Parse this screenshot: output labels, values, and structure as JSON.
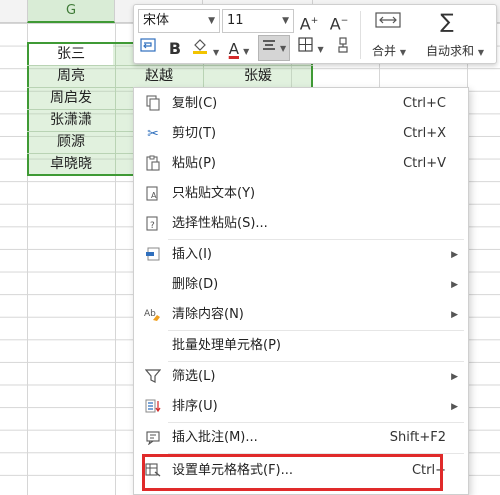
{
  "sheet": {
    "column_g": "G",
    "cells": {
      "g1": "张三",
      "g2": "周亮",
      "h2": "赵越",
      "i2": "张媛",
      "g3": "周启发",
      "g4": "张潇潇",
      "g5": "顾源",
      "g6": "卓晓晓"
    }
  },
  "toolbar": {
    "font_name": "宋体",
    "font_size": "11",
    "increase_font_icon": "A⁺",
    "decrease_font_icon": "A⁻",
    "bold_label": "B",
    "font_color_label": "A",
    "merge_label": "合并",
    "autosum_label": "自动求和",
    "colors": {
      "font_color": "#d42a2a",
      "fill_color": "#f2c400"
    }
  },
  "context_menu": {
    "items": {
      "copy": {
        "label": "复制(C)",
        "shortcut": "Ctrl+C",
        "icon": "copy-icon"
      },
      "cut": {
        "label": "剪切(T)",
        "shortcut": "Ctrl+X",
        "icon": "scissors-icon"
      },
      "paste": {
        "label": "粘贴(P)",
        "shortcut": "Ctrl+V",
        "icon": "paste-icon"
      },
      "paste_text": {
        "label": "只粘贴文本(Y)",
        "icon": "paste-text-icon"
      },
      "paste_special": {
        "label": "选择性粘贴(S)...",
        "icon": "paste-special-icon"
      },
      "insert": {
        "label": "插入(I)",
        "icon": "insert-icon"
      },
      "delete": {
        "label": "删除(D)"
      },
      "clear": {
        "label": "清除内容(N)",
        "icon": "clear-icon"
      },
      "batch": {
        "label": "批量处理单元格(P)"
      },
      "filter": {
        "label": "筛选(L)",
        "icon": "filter-icon"
      },
      "sort": {
        "label": "排序(U)",
        "icon": "sort-icon"
      },
      "comment": {
        "label": "插入批注(M)...",
        "shortcut": "Shift+F2",
        "icon": "comment-icon"
      },
      "format_cells": {
        "label": "设置单元格格式(F)...",
        "shortcut": "Ctrl+",
        "icon": "format-cells-icon"
      }
    }
  },
  "colors": {
    "selection_border": "#3f9a35",
    "highlight": "#e02a2a"
  }
}
